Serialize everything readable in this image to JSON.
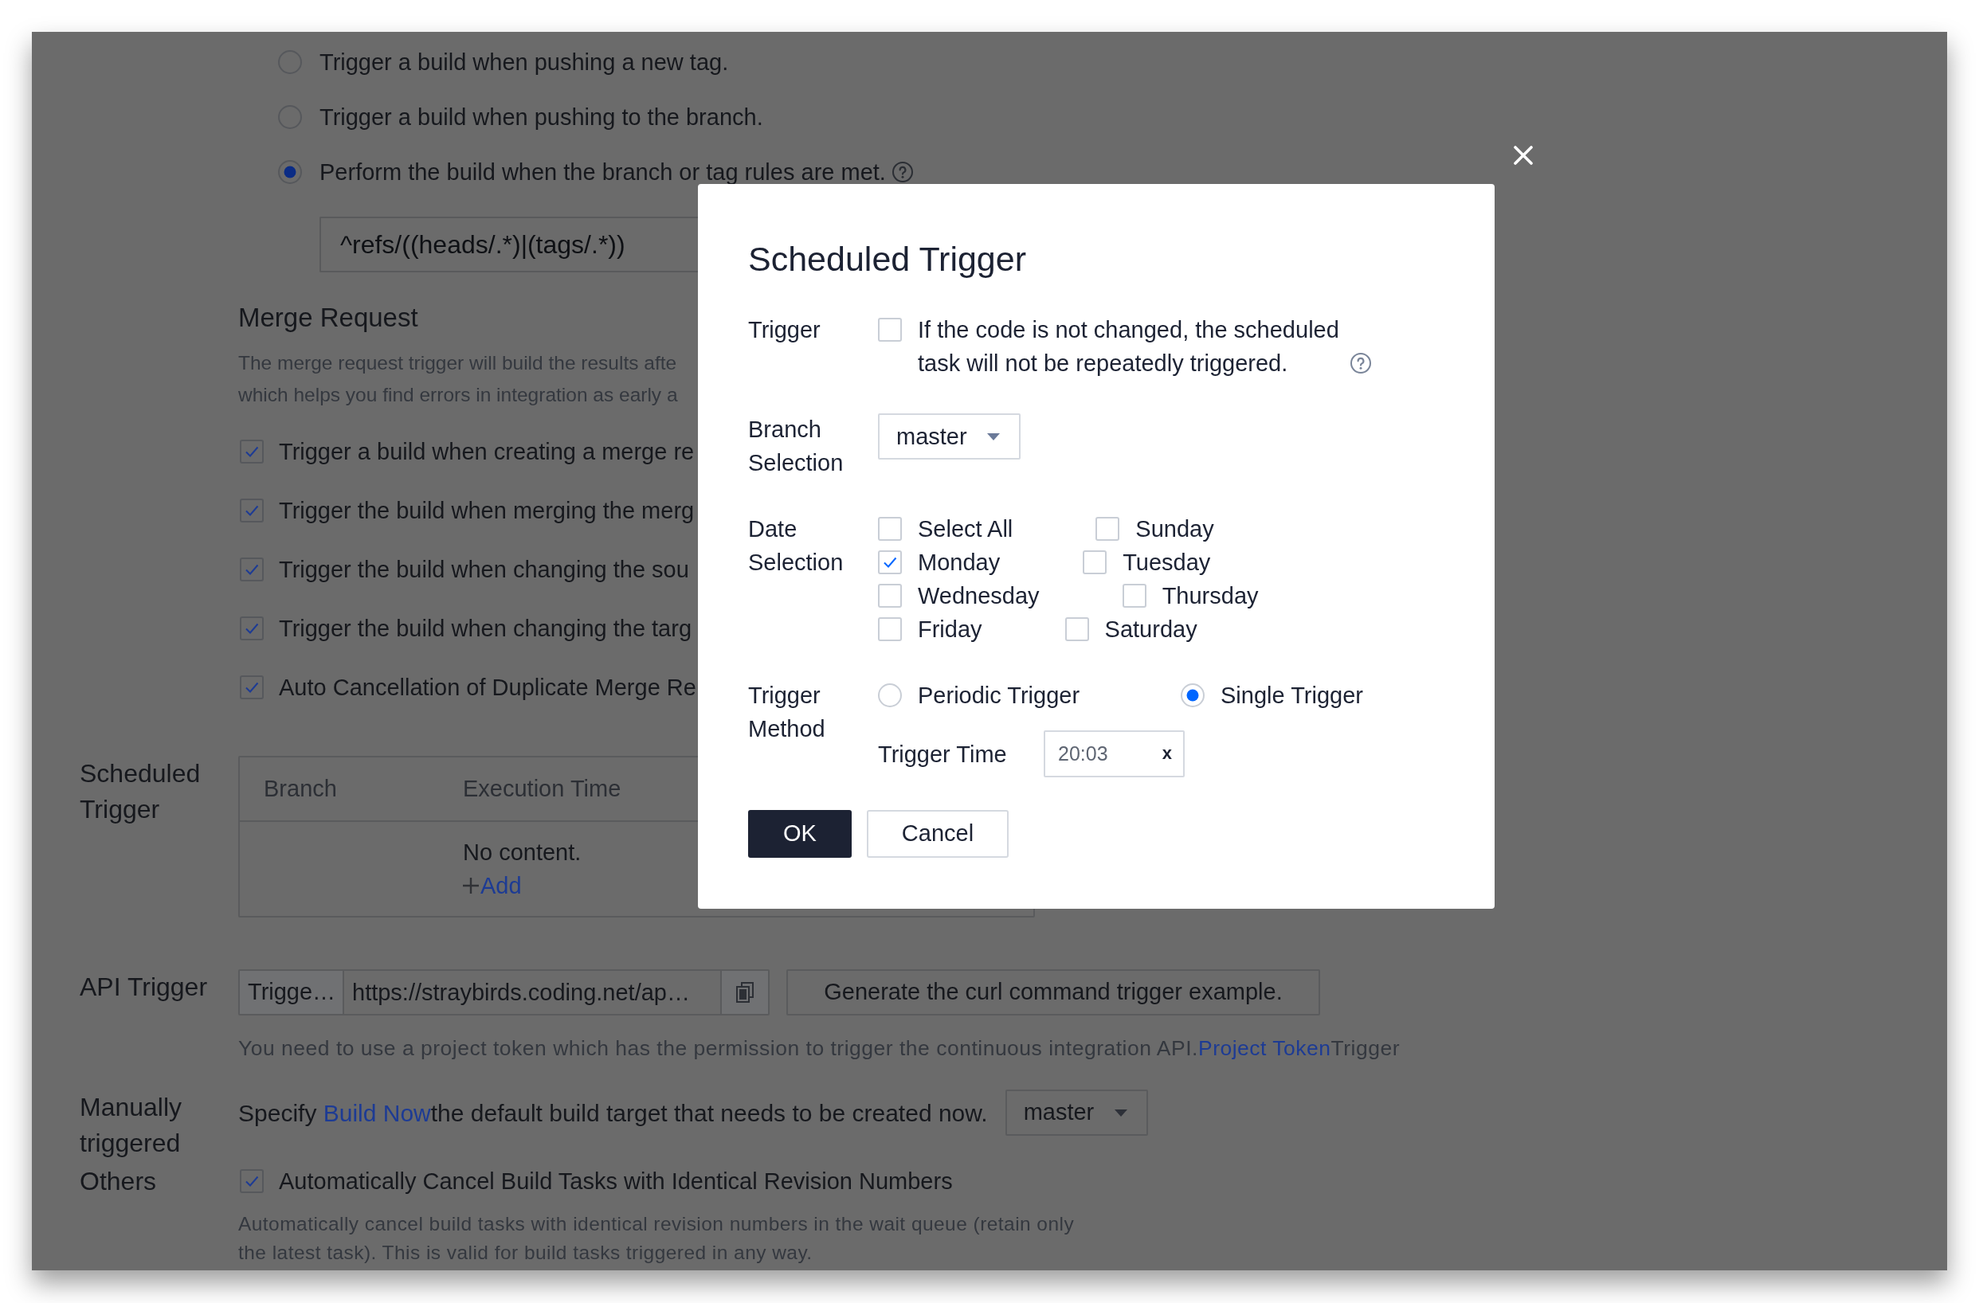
{
  "background": {
    "push_options": [
      {
        "label": "Trigger a build when pushing a new tag.",
        "selected": false
      },
      {
        "label": "Trigger a build when pushing to the branch.",
        "selected": false
      },
      {
        "label": "Perform the build when the branch or tag rules are met.",
        "selected": true,
        "help": true
      }
    ],
    "rule_field": {
      "value": "^refs/((heads/.*)|(tags/.*))"
    },
    "merge_request": {
      "title": "Merge Request",
      "description_lines": [
        "The merge request trigger will build the results afte",
        "which helps you find errors in integration as early a"
      ],
      "options": [
        {
          "label": "Trigger a build when creating a merge re",
          "checked": true
        },
        {
          "label": "Trigger the build when merging the merg",
          "checked": true
        },
        {
          "label": "Trigger the build when changing the sou",
          "checked": true
        },
        {
          "label": "Trigger the build when changing the targ",
          "checked": true
        },
        {
          "label": "Auto Cancellation of Duplicate Merge Re",
          "checked": true
        }
      ]
    },
    "scheduled_trigger": {
      "label": "Scheduled Trigger",
      "table": {
        "columns": [
          "Branch",
          "Execution Time"
        ],
        "empty_text": "No content.",
        "add_link": "Add"
      }
    },
    "api_trigger": {
      "label": "API Trigger",
      "token_name": "Trigge…",
      "url": "https://straybirds.coding.net/ap…",
      "generate_button": "Generate the curl command trigger example.",
      "note": {
        "text": "You need to use a project token which has the permission to trigger the continuous integration API.",
        "link": "Project Token",
        "text_after": "Trigger"
      }
    },
    "manual_trigger": {
      "label": "Manually triggered",
      "text_before": "Specify ",
      "link": "Build Now",
      "text_after": "the default build target that needs to be created now.",
      "branch": "master"
    },
    "others": {
      "label": "Others",
      "option": {
        "label": "Automatically Cancel Build Tasks with Identical Revision Numbers",
        "checked": true
      },
      "description": "Automatically cancel build tasks with identical revision numbers in the wait queue (retain only the latest task). This is valid for build tasks triggered in any way."
    }
  },
  "dialog": {
    "title": "Scheduled Trigger",
    "fields": [
      {
        "kind": "checkbox",
        "label": "Trigger",
        "text": "If the code is not changed, the scheduled task will not be repeatedly triggered.",
        "checked": false,
        "help": true
      },
      {
        "kind": "select",
        "label": "Branch Selection",
        "value": "master"
      },
      {
        "kind": "checkbox_group",
        "label": "Date Selection",
        "options": [
          {
            "label": "Select All",
            "checked": false
          },
          {
            "label": "Sunday",
            "checked": false
          },
          {
            "label": "Monday",
            "checked": true
          },
          {
            "label": "Tuesday",
            "checked": false
          },
          {
            "label": "Wednesday",
            "checked": false
          },
          {
            "label": "Thursday",
            "checked": false
          },
          {
            "label": "Friday",
            "checked": false
          },
          {
            "label": "Saturday",
            "checked": false
          }
        ]
      },
      {
        "kind": "radio_group",
        "label": "Trigger Method",
        "options": [
          {
            "label": "Periodic Trigger",
            "selected": false
          },
          {
            "label": "Single Trigger",
            "selected": true
          }
        ],
        "time": {
          "label": "Trigger Time",
          "value": "20:03",
          "clear": "x"
        }
      }
    ],
    "buttons": [
      {
        "label": "OK",
        "kind": "primary"
      },
      {
        "label": "Cancel",
        "kind": "secondary"
      }
    ]
  }
}
